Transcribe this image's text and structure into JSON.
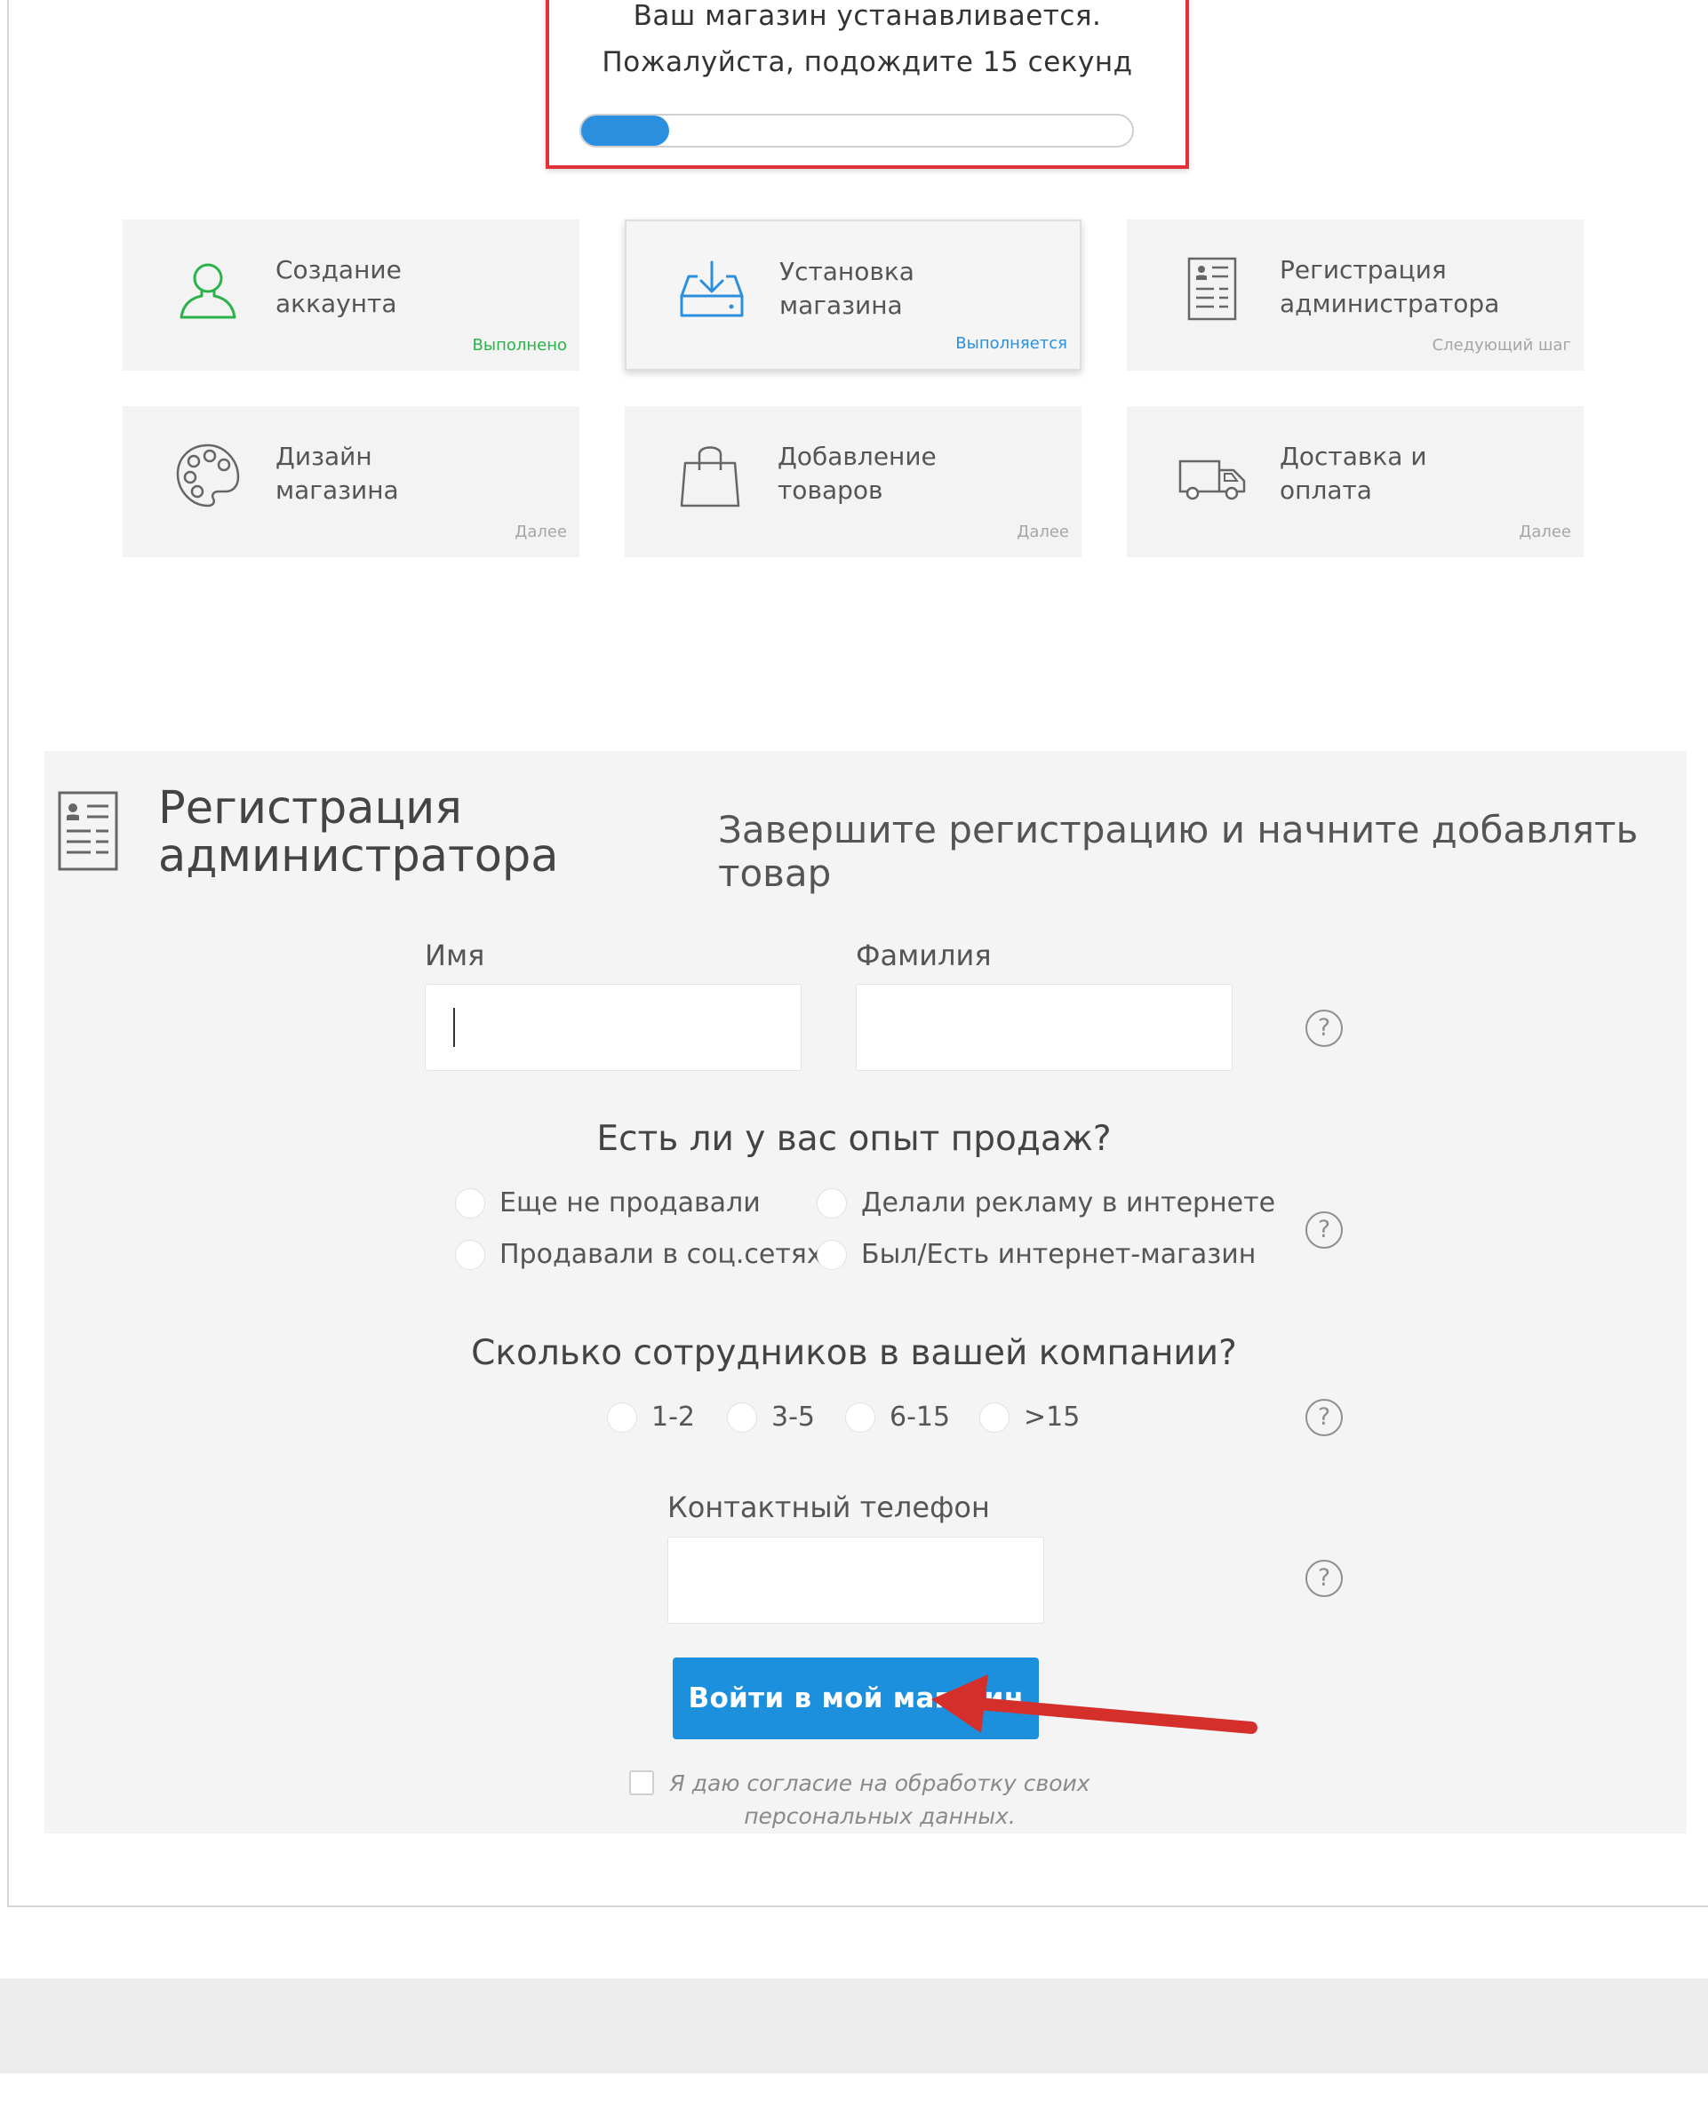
{
  "install_notice": {
    "line1": "Ваш магазин устанавливается.",
    "line2": "Пожалуйста, подождите 15 секунд",
    "progress": 0.16,
    "progress_color": "#2b8fe0"
  },
  "steps": [
    {
      "label_line1": "Создание",
      "label_line2": "аккаунта",
      "status": "Выполнено",
      "icon": "user-icon",
      "state": "done"
    },
    {
      "label_line1": "Установка",
      "label_line2": "магазина",
      "status": "Выполняется",
      "icon": "download-tray-icon",
      "state": "in-progress"
    },
    {
      "label_line1": "Регистрация",
      "label_line2": "администратора",
      "status": "Следующий шаг",
      "icon": "id-card-icon",
      "state": "next"
    },
    {
      "label_line1": "Дизайн",
      "label_line2": "магазина",
      "status": "Далее",
      "icon": "palette-icon",
      "state": "later"
    },
    {
      "label_line1": "Добавление",
      "label_line2": "товаров",
      "status": "Далее",
      "icon": "shopping-bag-icon",
      "state": "later"
    },
    {
      "label_line1": "Доставка и",
      "label_line2": "оплата",
      "status": "Далее",
      "icon": "delivery-truck-icon",
      "state": "later"
    }
  ],
  "registration": {
    "title_line1": "Регистрация",
    "title_line2": "администратора",
    "subtitle": "Завершите регистрацию и начните добавлять товар",
    "first_name": {
      "label": "Имя",
      "value": ""
    },
    "last_name": {
      "label": "Фамилия",
      "value": ""
    },
    "experience": {
      "question": "Есть ли у вас опыт продаж?",
      "options": [
        "Еще не продавали",
        "Делали рекламу в интернете",
        "Продавали в соц.сетях",
        "Был/Есть интернет-магазин"
      ]
    },
    "employees": {
      "question": "Сколько сотрудников в вашей компании?",
      "options": [
        "1-2",
        "3-5",
        "6-15",
        ">15"
      ]
    },
    "phone": {
      "label": "Контактный телефон",
      "value": ""
    },
    "help_symbol": "?",
    "submit_label": "Войти в мой магазин",
    "consent_line1": "Я даю согласие на обработку своих",
    "consent_line2": "персональных данных.",
    "consent_checked": false
  },
  "colors": {
    "accent": "#1d90dd",
    "done": "#2bb34a",
    "highlight": "#e2313a"
  }
}
